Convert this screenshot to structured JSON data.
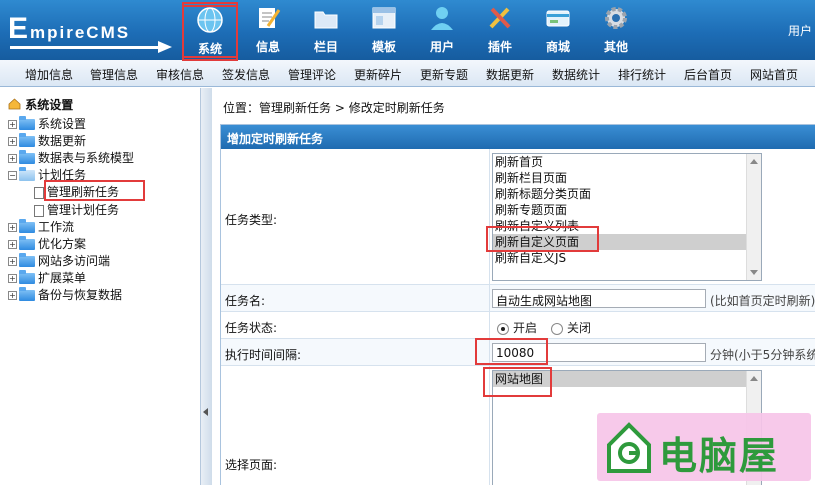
{
  "logo": {
    "big": "E",
    "rest": "mpireCMS"
  },
  "nav": [
    {
      "label": "系统",
      "icon": "globe-icon",
      "active": true
    },
    {
      "label": "信息",
      "icon": "edit-icon"
    },
    {
      "label": "栏目",
      "icon": "folder-icon"
    },
    {
      "label": "模板",
      "icon": "window-icon"
    },
    {
      "label": "用户",
      "icon": "user-icon"
    },
    {
      "label": "插件",
      "icon": "tools-icon"
    },
    {
      "label": "商城",
      "icon": "card-icon"
    },
    {
      "label": "其他",
      "icon": "gear-icon"
    }
  ],
  "user_label": "用户",
  "submenu": [
    "增加信息",
    "管理信息",
    "审核信息",
    "签发信息",
    "管理评论",
    "更新碎片",
    "更新专题",
    "数据更新",
    "数据统计",
    "排行统计",
    "后台首页",
    "网站首页"
  ],
  "tree": {
    "title": "系统设置",
    "items": [
      "系统设置",
      "数据更新",
      "数据表与系统模型",
      "计划任务",
      "工作流",
      "优化方案",
      "网站多访问端",
      "扩展菜单",
      "备份与恢复数据"
    ],
    "children": [
      "管理刷新任务",
      "管理计划任务"
    ]
  },
  "crumb": {
    "prefix": "位置：",
    "link1": "管理刷新任务",
    "sep": " > ",
    "link2": "修改定时刷新任务"
  },
  "form": {
    "title": "增加定时刷新任务",
    "type_label": "任务类型:",
    "type_options": [
      "刷新首页",
      "刷新栏目页面",
      "刷新标题分类页面",
      "刷新专题页面",
      "刷新自定义列表",
      "刷新自定义页面",
      "刷新自定义JS"
    ],
    "type_selected_index": 5,
    "name_label": "任务名:",
    "name_value": "自动生成网站地图",
    "name_hint": "(比如首页定时刷新)",
    "status_label": "任务状态:",
    "status_on": "开启",
    "status_off": "关闭",
    "interval_label": "执行时间间隔:",
    "interval_value": "10080",
    "interval_hint": "分钟(小于5分钟系统",
    "page_label": "选择页面:",
    "page_options": [
      "网站地图"
    ]
  },
  "watermark": {
    "text": "电脑屋"
  },
  "colors": {
    "header": "#1d6db6",
    "highlight": "#e23b3b",
    "watermark_bg": "#f6c4e8",
    "watermark_text": "#2e9a3c"
  }
}
